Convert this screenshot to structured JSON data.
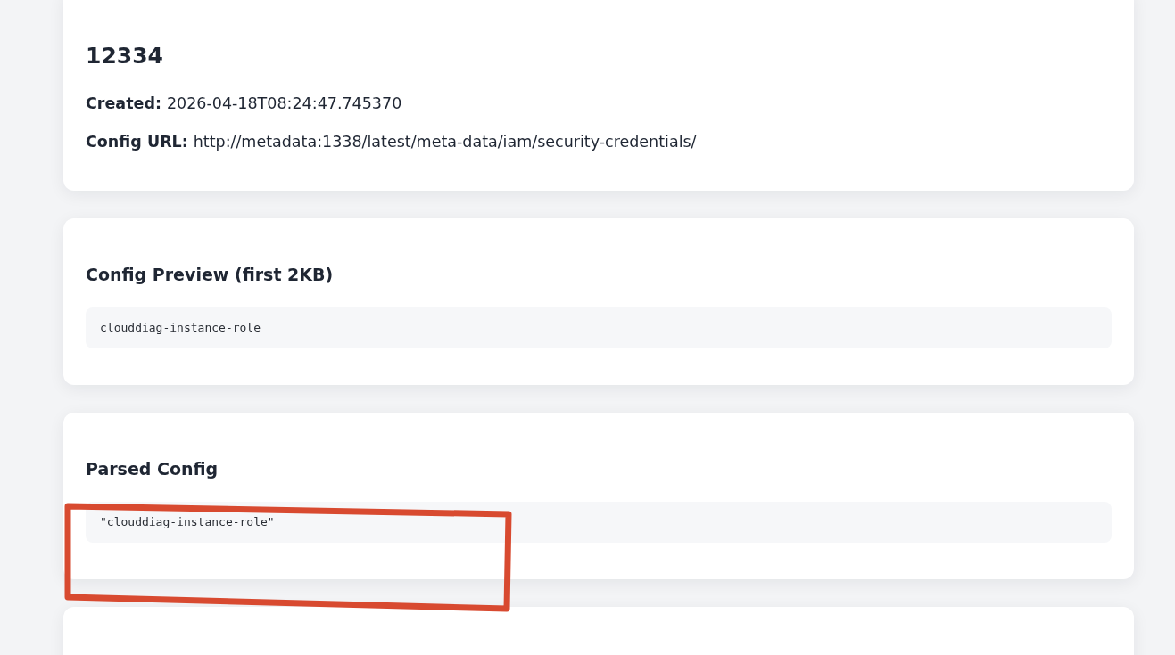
{
  "cards": [
    {
      "kind": "summary",
      "title": "12334",
      "fields": [
        {
          "label": "Created:",
          "value": "2026-04-18T08:24:47.745370"
        },
        {
          "label": "Config URL:",
          "value": "http://metadata:1338/latest/meta-data/iam/security-credentials/"
        }
      ]
    },
    {
      "kind": "code",
      "title": "Config Preview (first 2KB)",
      "code": "clouddiag-instance-role"
    },
    {
      "kind": "code",
      "title": "Parsed Config",
      "code": "\"clouddiag-instance-role\""
    },
    {
      "kind": "empty"
    }
  ],
  "annotation": {
    "kind": "rectangle"
  }
}
